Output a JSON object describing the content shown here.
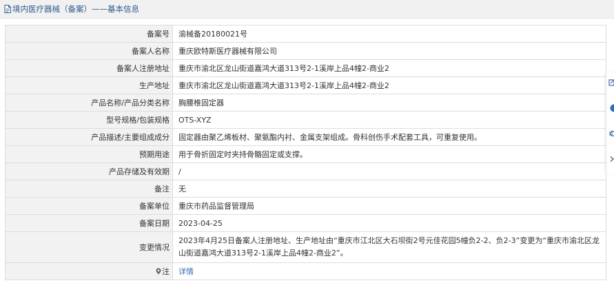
{
  "page": {
    "title": "境内医疗器械（备案）——基本信息"
  },
  "rows": [
    {
      "label": "备案号",
      "value": "渝械备20180021号"
    },
    {
      "label": "备案人名称",
      "value": "重庆欧特斯医疗器械有限公司"
    },
    {
      "label": "备案人注册地址",
      "value": "重庆市渝北区龙山街道嘉鸿大道313号2-1溪岸上品4幢2-商业2"
    },
    {
      "label": "生产地址",
      "value": "重庆市渝北区龙山街道嘉鸿大道313号2-1溪岸上品4幢2-商业2"
    },
    {
      "label": "产品名称/产品分类名称",
      "value": "胸腰椎固定器"
    },
    {
      "label": "型号规格/包装规格",
      "value": "OTS-XYZ"
    },
    {
      "label": "产品描述/主要组成成分",
      "value": "固定器由聚乙烯板材、聚氨酯内衬、金属支架组成。骨科创伤手术配套工具，可重复使用。"
    },
    {
      "label": "预期用途",
      "value": "用于骨折固定时夹持骨骼固定或支撑。"
    },
    {
      "label": "产品存储及有效期",
      "value": "/"
    },
    {
      "label": "备注",
      "value": "无"
    },
    {
      "label": "备案单位",
      "value": "重庆市药品监督管理局"
    },
    {
      "label": "备案日期",
      "value": "2023-04-25"
    },
    {
      "label": "变更情况",
      "value": "2023年4月25日备案人注册地址、生产地址由“重庆市江北区大石坝街2号元佳花园5幢负2-2、负2-3”变更为“重庆市渝北区龙山街道嘉鸿大道313号2-1溪岸上品4幢2-商业2”。"
    }
  ],
  "note": {
    "label": "注",
    "link_text": "详情"
  },
  "icons": {
    "title": "document-icon",
    "note": "pin-icon",
    "sidebar": [
      "edit-icon",
      "help-icon",
      "share-icon",
      "collapse-icon"
    ]
  },
  "colors": {
    "title": "#2f5b8d",
    "link": "#2f6fb3",
    "label_bg": "#f2f2f2",
    "header_bg": "#f1f1f1",
    "border": "#dcdcdc"
  }
}
